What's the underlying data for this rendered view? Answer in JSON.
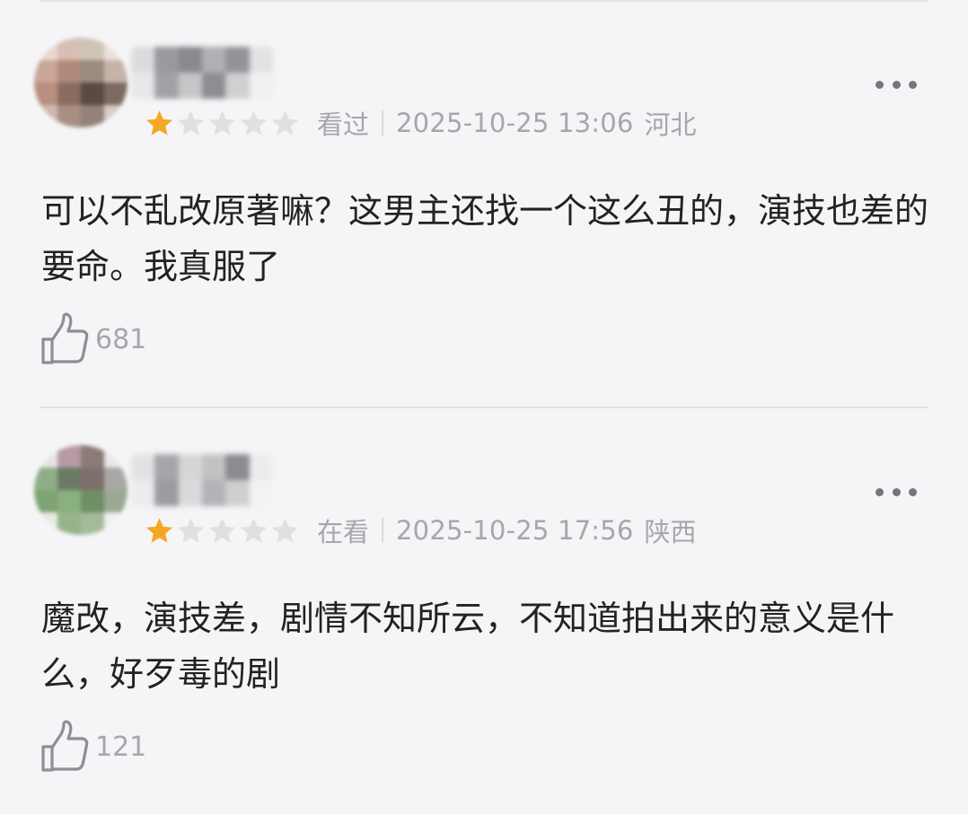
{
  "reviews": [
    {
      "rating": 1,
      "status": "看过",
      "datetime": "2025-10-25 13:06",
      "region": "河北",
      "content": "可以不乱改原著嘛？这男主还找一个这么丑的，演技也差的要命。我真服了",
      "likes": "681"
    },
    {
      "rating": 1,
      "status": "在看",
      "datetime": "2025-10-25 17:56",
      "region": "陕西",
      "content": "魔改，演技差，剧情不知所云，不知道拍出来的意义是什么，好歹毒的剧",
      "likes": "121"
    }
  ],
  "colors": {
    "star_filled": "#f5a623",
    "star_empty": "#e0e0e2",
    "meta_text": "#a6a6ab",
    "body_text": "#222222",
    "background": "#f5f5f7"
  },
  "icons": [
    "star-icon",
    "more-icon",
    "thumbs-up-icon"
  ]
}
